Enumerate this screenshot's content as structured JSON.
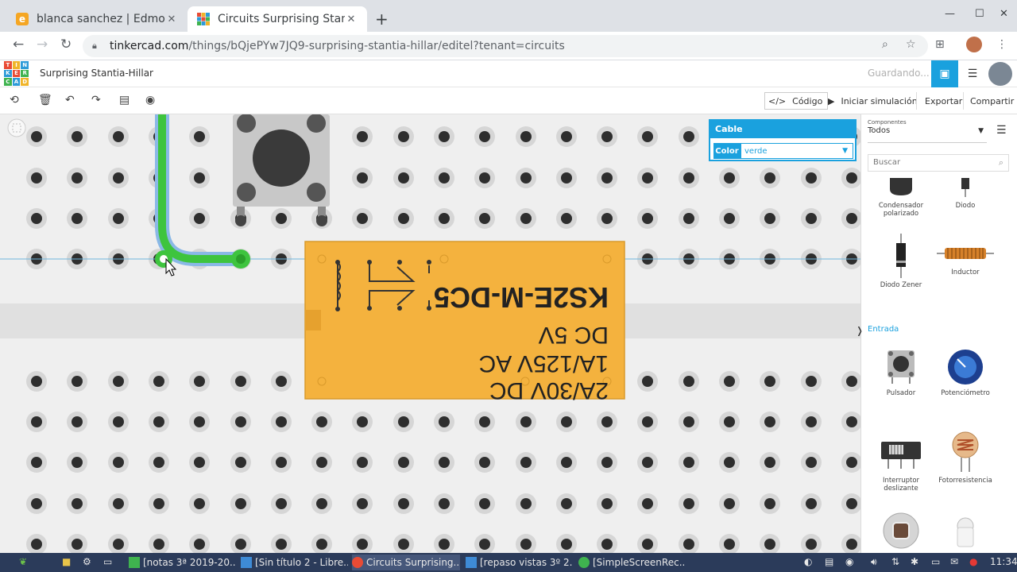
{
  "browser": {
    "tabs": [
      {
        "title": "blanca sanchez | Edmodo",
        "favicon": "edmodo-icon",
        "active": false
      },
      {
        "title": "Circuits Surprising Stanti",
        "favicon": "tinkercad-icon",
        "active": true
      }
    ],
    "url_domain": "tinkercad.com",
    "url_path": "/things/bQjePYw7JQ9-surprising-stantia-hillar/editel?tenant=circuits"
  },
  "app": {
    "logo_letters": [
      "T",
      "I",
      "N",
      "K",
      "E",
      "R",
      "C",
      "A",
      "D"
    ],
    "project_title": "Surprising Stantia-Hillar",
    "save_status": "Guardando...",
    "toolbar": {
      "code_label": "Código",
      "simulate_label": "Iniciar simulación",
      "export_label": "Exportar",
      "share_label": "Compartir"
    }
  },
  "inspector": {
    "title": "Cable",
    "color_label": "Color",
    "color_value": "verde"
  },
  "relay": {
    "line1": "2A/30V DC",
    "line2": "1A/125V AC",
    "line3": "DC 5V",
    "line4": "KS2E-M-DC5"
  },
  "panel": {
    "components_small_label": "Componentes",
    "components_value": "Todos",
    "search_placeholder": "Buscar",
    "items_top": [
      "Condensador polarizado",
      "Diodo",
      "Diodo Zener",
      "Inductor"
    ],
    "section_input": "Entrada",
    "items_input": [
      "Pulsador",
      "Potenciómetro",
      "Interruptor deslizante",
      "Fotorresistencia"
    ]
  },
  "taskbar": {
    "tasks": [
      "[notas 3ª 2019-20...",
      "[Sin título 2 - Libre...",
      "Circuits Surprising...",
      "[repaso vistas 3º 2...",
      "[SimpleScreenRec..."
    ],
    "clock": "11:34"
  },
  "colors": {
    "accent": "#1aa1de",
    "wire": "#3ec43e",
    "relay": "#f4b23e"
  }
}
